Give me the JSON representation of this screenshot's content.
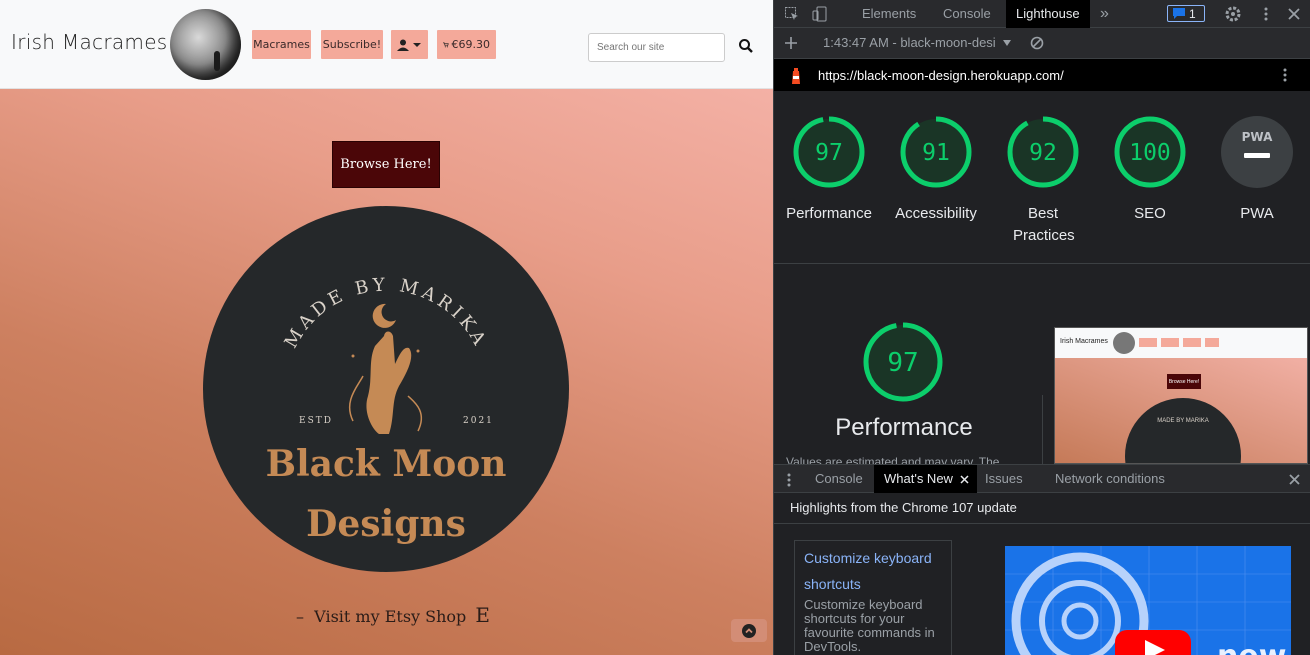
{
  "site": {
    "brand": "Irish Macrames",
    "nav": {
      "macrames": "Macrames",
      "subscribe": "Subscribe!",
      "cart_total": "€69.30"
    },
    "search": {
      "placeholder": "Search our site"
    },
    "browse_button": "Browse Here!",
    "hero_logo": {
      "arc_text": "MADE BY MARIKA",
      "estd_label": "ESTD",
      "year": "2021",
      "line1": "Black Moon",
      "line2": "Designs"
    },
    "etsy_link": "Visit my Etsy Shop",
    "etsy_glyph": "E"
  },
  "devtools": {
    "tabs": [
      "Elements",
      "Console",
      "Lighthouse"
    ],
    "active_tab": "Lighthouse",
    "issues_count": "1",
    "report_time": "1:43:47 AM - black-moon-desi",
    "url": "https://black-moon-design.herokuapp.com/",
    "scores": [
      {
        "label": "Performance",
        "value": "97"
      },
      {
        "label": "Accessibility",
        "value": "91"
      },
      {
        "label": "Best Practices",
        "value": "92"
      },
      {
        "label": "SEO",
        "value": "100"
      },
      {
        "label": "PWA",
        "value": "PWA"
      }
    ],
    "performance_score": "97",
    "performance_title": "Performance",
    "performance_note": "Values are estimated and may vary. The",
    "thumbnail": {
      "brand": "Irish Macrames",
      "button": "Browse Here!",
      "arc_text": "MADE BY MARIKA"
    },
    "drawer_tabs": [
      "Console",
      "What's New",
      "Issues",
      "Network conditions"
    ],
    "drawer_active": "What's New",
    "whats_new_heading": "Highlights from the Chrome 107 update",
    "whats_new_card": {
      "link": "Customize keyboard shortcuts",
      "description": "Customize keyboard shortcuts for your favourite commands in DevTools."
    },
    "whats_new_image_text": "new",
    "colors": {
      "pass": "#0cce6b",
      "pwa_gray": "#3c4043",
      "accent": "#8ab4f8"
    }
  }
}
